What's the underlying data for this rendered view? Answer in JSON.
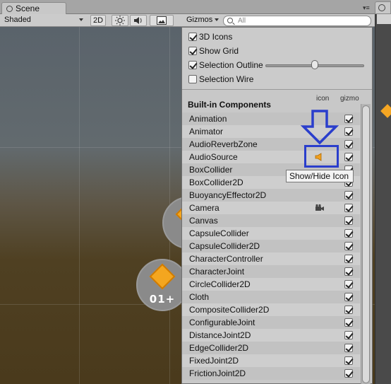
{
  "window": {
    "tab_title": "Scene"
  },
  "toolbar": {
    "shading_mode": "Shaded",
    "mode_2d": "2D",
    "gizmos_label": "Gizmos",
    "search_placeholder": "All"
  },
  "gizmos_panel": {
    "options": [
      {
        "label": "3D Icons",
        "checked": true
      },
      {
        "label": "Show Grid",
        "checked": true
      },
      {
        "label": "Selection Outline",
        "checked": true
      },
      {
        "label": "Selection Wire",
        "checked": false
      }
    ],
    "section_title": "Built-in Components",
    "col_icon": "icon",
    "col_gizmo": "gizmo",
    "components": [
      "Animation",
      "Animator",
      "AudioReverbZone",
      "AudioSource",
      "BoxCollider",
      "BoxCollider2D",
      "BuoyancyEffector2D",
      "Camera",
      "Canvas",
      "CapsuleCollider",
      "CapsuleCollider2D",
      "CharacterController",
      "CharacterJoint",
      "CircleCollider2D",
      "Cloth",
      "CompositeCollider2D",
      "ConfigurableJoint",
      "DistanceJoint2D",
      "EdgeCollider2D",
      "FixedJoint2D",
      "FrictionJoint2D"
    ],
    "tooltip": "Show/Hide Icon"
  },
  "scene_sprites": [
    {
      "score_text": "01+"
    }
  ],
  "colors": {
    "highlight": "#2a3ecc",
    "sprite_diamond": "#f4a61f"
  }
}
